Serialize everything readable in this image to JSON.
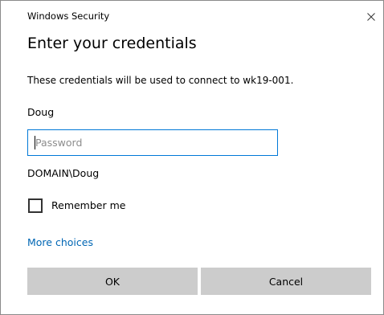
{
  "window": {
    "title": "Windows Security",
    "close_icon": "close-icon"
  },
  "dialog": {
    "heading": "Enter your credentials",
    "description": "These credentials will be used to connect to wk19-001.",
    "username": "Doug",
    "password": {
      "value": "",
      "placeholder": "Password"
    },
    "domain_user": "DOMAIN\\Doug",
    "remember_me": {
      "label": "Remember me",
      "checked": false
    },
    "more_choices": "More choices"
  },
  "buttons": {
    "ok": "OK",
    "cancel": "Cancel"
  },
  "colors": {
    "accent": "#0078d7",
    "link": "#0066b4",
    "button_bg": "#cccccc"
  }
}
